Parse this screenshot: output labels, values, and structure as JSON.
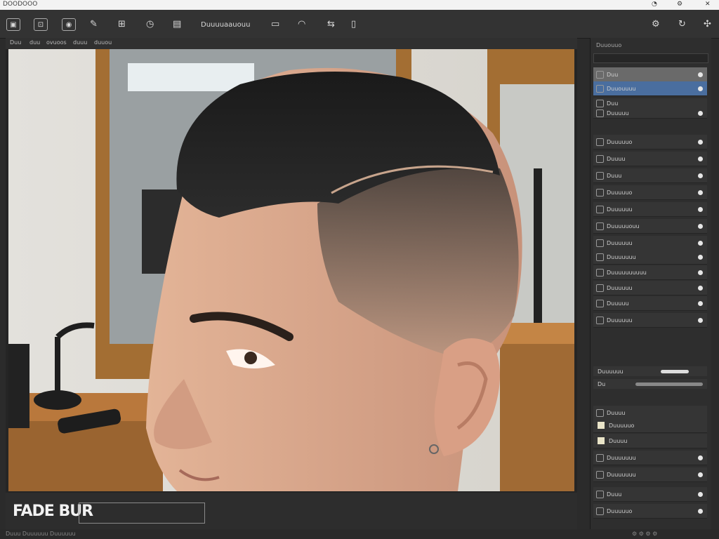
{
  "window": {
    "title": "DOODOOO",
    "controls": [
      "◔",
      "⚙",
      "✕"
    ]
  },
  "toolbar": {
    "icons": [
      "image-icon",
      "crop-icon",
      "camera-icon",
      "brush-icon",
      "box-icon",
      "clock-icon",
      "layers-icon"
    ],
    "text_label": "Duuuuaauouu",
    "right_icons": [
      "gear-icon",
      "refresh-icon",
      "share-icon"
    ]
  },
  "document": {
    "tabs": [
      "Duu",
      "duu",
      "ovuoos",
      "duuu",
      "duuou"
    ]
  },
  "caption": {
    "text": "FADE BUR"
  },
  "panel": {
    "title": "Duuouuo",
    "layers": [
      {
        "label": "Duu",
        "style": "top"
      },
      {
        "label": "Duuouuuu",
        "style": "sel"
      },
      {
        "label": "Duu",
        "style": ""
      },
      {
        "label": "Duuuuu",
        "style": ""
      },
      {
        "label": "Duuuuuo",
        "style": ""
      },
      {
        "label": "Duuuu",
        "style": ""
      },
      {
        "label": "Duuu",
        "style": ""
      },
      {
        "label": "Duuuuuo",
        "style": ""
      },
      {
        "label": "Duuuuuu",
        "style": ""
      },
      {
        "label": "Duuuuuouu",
        "style": ""
      },
      {
        "label": "Duuuuuu",
        "style": ""
      },
      {
        "label": "Duuuuuuu",
        "style": ""
      },
      {
        "label": "Duuuuuuuuuu",
        "style": ""
      },
      {
        "label": "Duuuuuu",
        "style": ""
      },
      {
        "label": "Duuuuu",
        "style": ""
      },
      {
        "label": "Duuuuuu",
        "style": ""
      }
    ],
    "sliders": [
      {
        "label": "Duuuuuu"
      },
      {
        "label": "Du"
      }
    ],
    "lower_items": [
      {
        "label": "Duuuu"
      },
      {
        "label": "Duuuuuo"
      },
      {
        "label": "Duuuu"
      },
      {
        "label": "Duuuuuuu"
      }
    ],
    "bottom_layers": [
      {
        "label": "Duuuuuuu"
      },
      {
        "label": "Duuu"
      },
      {
        "label": "Duuuuuo"
      },
      {
        "label": "Duuuuuu"
      }
    ]
  },
  "status": {
    "left": "Duuu  Duuuuuu  Duuuuuu",
    "right": "⚙ ⚙ ⚙ ⚙"
  },
  "colors": {
    "accent": "#4a6e9f",
    "panel": "#2e2e2e",
    "toolbar": "#333333"
  }
}
